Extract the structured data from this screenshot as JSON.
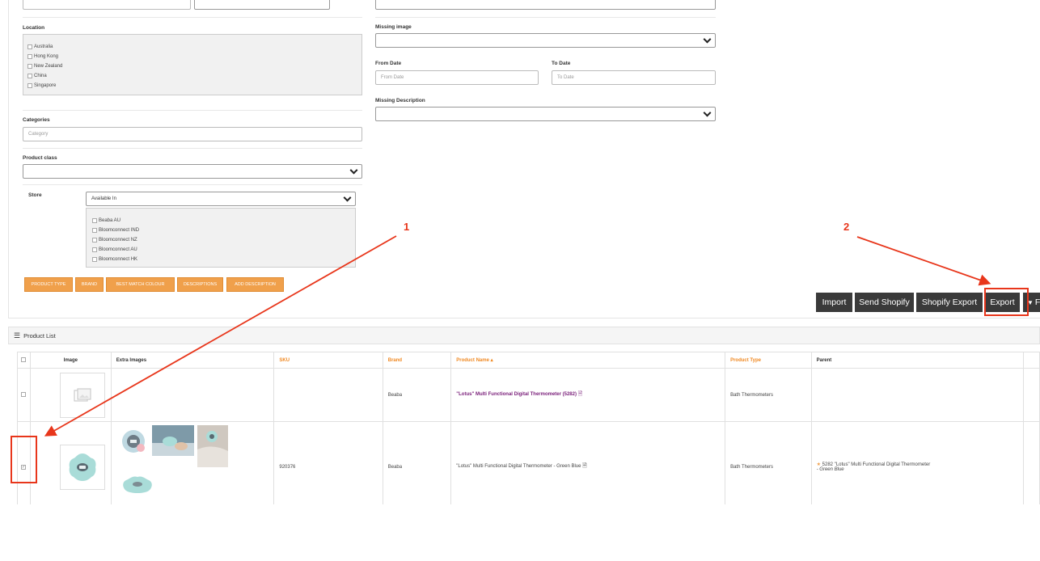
{
  "filters": {
    "top_left_input": "",
    "top_left_select": "",
    "top_right_select": "",
    "location": {
      "label": "Location",
      "options": [
        "Australia",
        "Hong Kong",
        "New Zealand",
        "China",
        "Singapore"
      ]
    },
    "categories": {
      "label": "Categories",
      "placeholder": "Category"
    },
    "product_class": {
      "label": "Product class",
      "value": ""
    },
    "store": {
      "label": "Store",
      "select_value": "Available In",
      "options": [
        "Beaba AU",
        "Bloomconnect IND",
        "Bloomconnect NZ",
        "Bloomconnect AU",
        "Bloomconnect HK"
      ]
    },
    "missing_image": {
      "label": "Missing image",
      "value": ""
    },
    "from_date": {
      "label": "From Date",
      "placeholder": "From Date"
    },
    "to_date": {
      "label": "To Date",
      "placeholder": "To Date"
    },
    "missing_description": {
      "label": "Missing Description",
      "value": ""
    }
  },
  "tag_buttons": [
    "PRODUCT TYPE",
    "BRAND",
    "BEST MATCH COLOUR",
    "DESCRIPTIONS",
    "ADD DESCRIPTION"
  ],
  "action_buttons": {
    "import": "Import",
    "send_shopify": "Send Shopify",
    "shopify_export": "Shopify Export",
    "export": "Export",
    "filter_partial": "F"
  },
  "product_list": {
    "title": "Product List",
    "columns": [
      "Image",
      "Extra Images",
      "SKU",
      "Brand",
      "Product Name",
      "Product Type",
      "Parent"
    ],
    "sort_indicator": "▴",
    "rows": [
      {
        "sku": "",
        "brand": "Beaba",
        "product_name": "\"Lotus\" Multi Functional Digital Thermometer  (5282)",
        "product_type": "Bath Thermometers",
        "parent": "",
        "parent_variant": ""
      },
      {
        "sku": "920376",
        "brand": "Beaba",
        "product_name": "\"Lotus\" Multi Functional Digital Thermometer - Green Blue",
        "product_type": "Bath Thermometers",
        "parent": "5282 \"Lotus\" Multi Functional Digital Thermometer",
        "parent_variant": "- Green Blue"
      }
    ]
  },
  "annotations": {
    "first": "1",
    "second": "2"
  },
  "colors": {
    "accent_orange": "#f0a04b",
    "annotation_red": "#e8361b",
    "dark_button": "#3a3a3a",
    "link_purple": "#7a1f7a"
  },
  "icons": [
    "chevron-down-icon",
    "list-icon",
    "filter-icon",
    "image-placeholder-icon",
    "file-icon",
    "star-icon",
    "checkmark-icon"
  ]
}
